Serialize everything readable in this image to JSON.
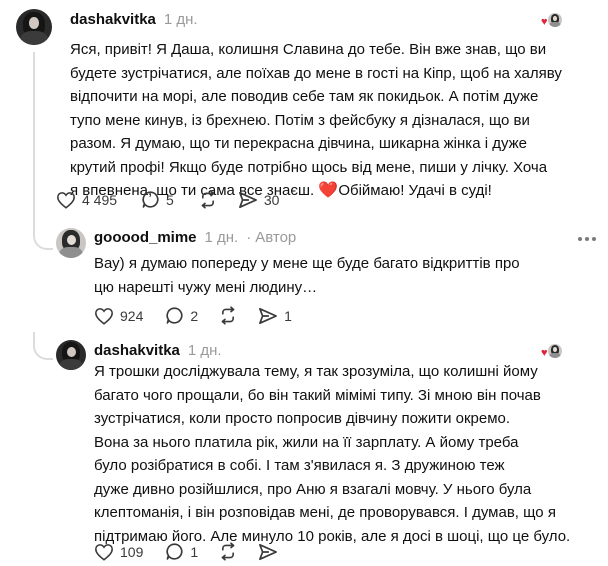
{
  "colors": {
    "heart": "#e0233b",
    "muted": "#9a9a9a",
    "text": "#101010",
    "thread": "#dcdcdc"
  },
  "post1": {
    "username": "dashakvitka",
    "time": "1 дн.",
    "lines": [
      "Яся, привіт! Я Даша, колишня Славина до тебе. Він вже знав, що ви",
      "будете зустрічатися, але поїхав до мене в гості на Кіпр, щоб на халяву",
      "відпочити на морі, але поводив себе там як покидьок. А потім дуже",
      "тупо мене кинув, із брехнею. Потім з фейсбуку я дізналася, що ви",
      "разом. Я думаю, що ти перекрасна дівчина, шикарна жінка і дуже",
      "крутий профі! Якщо буде потрібно щось від мене, пиши у лічку. Хоча",
      "я впевнена, що ти сама все знаєш."
    ],
    "last_line_emoji": "❤️",
    "last_line_tail": "Обіймаю! Удачі в суді!",
    "likes": "4 495",
    "comments": "5",
    "shares": "30",
    "icons": [
      "heart-icon",
      "comment-icon",
      "repost-icon",
      "send-icon"
    ]
  },
  "reply": {
    "username": "gooood_mime",
    "time": "1 дн.",
    "separator": "·",
    "author_tag": "Автор",
    "lines": [
      "Вау) я думаю попереду у мене ще буде багато відкриттів про",
      "цю нарешті чужу мені людину…"
    ],
    "likes": "924",
    "comments": "2",
    "shares": "1"
  },
  "post2": {
    "username": "dashakvitka",
    "time": "1 дн.",
    "lines": [
      "Я трошки досліджувала тему, я так зрозуміла, що колишні йому",
      "багато чого прощали, бо він такий мімімі типу. Зі мною він почав",
      "зустрічатися, коли просто попросив дівчину пожити окремо.",
      "Вона за нього платила рік, жили на її зарплату. А йому треба",
      "було розібратися в собі. І там з'явилася я. З дружиною теж",
      "дуже дивно розійшлися, про Аню я взагалі мовчу. У нього була",
      "клептоманія, і він розповідав мені, де проворувався. І думав, що я",
      "підтримаю його. Але минуло 10 років, але я досі в шоці, що це було."
    ],
    "likes": "109",
    "comments": "1"
  }
}
